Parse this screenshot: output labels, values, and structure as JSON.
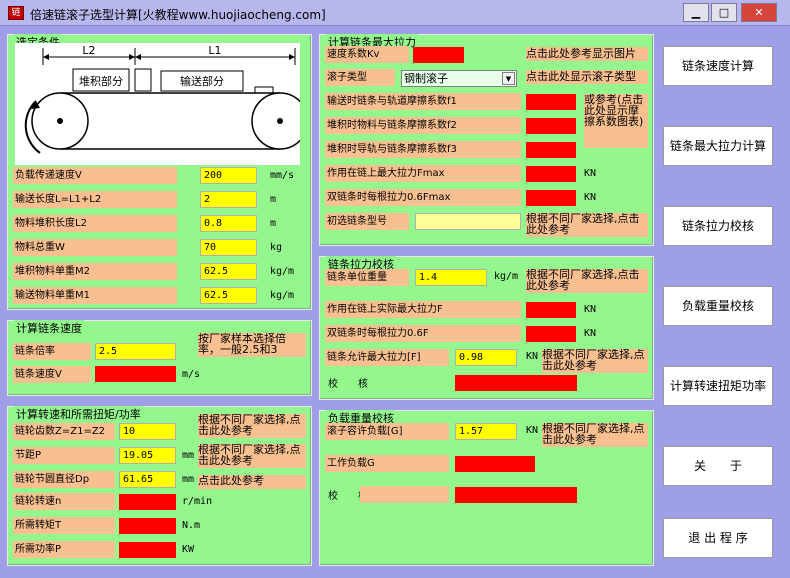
{
  "window": {
    "title": "倍速链滚子选型计算[火教程www.huojiaocheng.com]",
    "minimize": "▁",
    "maximize": "□",
    "close": "✕",
    "app_icon": "链"
  },
  "selection": {
    "title": "选定条件",
    "diagram": {
      "l2": "L2",
      "l1": "L1",
      "accum": "堆积部分",
      "convey": "输送部分"
    },
    "rows": [
      {
        "label": "负载传递速度V",
        "value": "200",
        "unit": "mm/s"
      },
      {
        "label": "输送长度L=L1+L2",
        "value": "2",
        "unit": "m"
      },
      {
        "label": "物料堆积长度L2",
        "value": "0.8",
        "unit": "m"
      },
      {
        "label": "物料总重W",
        "value": "70",
        "unit": "kg"
      },
      {
        "label": "堆积物料单重M2",
        "value": "62.5",
        "unit": "kg/m"
      },
      {
        "label": "输送物料单重M1",
        "value": "62.5",
        "unit": "kg/m"
      }
    ]
  },
  "speed": {
    "title": "计算链条速度",
    "ratio_label": "链条倍率",
    "ratio_value": "2.5",
    "ratio_note": "按厂家样本选择倍率，一般2.5和3",
    "speed_label": "链条速度V",
    "speed_unit": "m/s"
  },
  "torque": {
    "title": "计算转速和所需扭矩/功率",
    "teeth_label": "链轮齿数Z=Z1=Z2",
    "teeth_value": "10",
    "teeth_note": "根据不同厂家选择,点击此处参考",
    "pitch_label": "节距P",
    "pitch_value": "19.05",
    "pitch_unit": "mm",
    "pitch_note": "根据不同厂家选择,点击此处参考",
    "dia_label": "链轮节圆直径Dp",
    "dia_value": "61.65",
    "dia_unit": "mm",
    "dia_note": "点击此处参考",
    "rpm_label": "链轮转速n",
    "rpm_unit": "r/min",
    "tq_label": "所需转矩T",
    "tq_unit": "N.m",
    "pw_label": "所需功率P",
    "pw_unit": "KW"
  },
  "tension": {
    "title": "计算链条最大拉力",
    "kv_label": "速度系数Kv",
    "kv_note": "点击此处参考显示图片",
    "roller_label": "滚子类型",
    "roller_value": "钢制滚子",
    "roller_note": "点击此处显示滚子类型",
    "f1_label": "输送时链条与轨道摩擦系数f1",
    "f2_label": "堆积时物料与链条摩擦系数f2",
    "f3_label": "堆积时导轨与链条摩擦系数f3",
    "friction_note": "或参考(点击此处显示摩擦系数图表)",
    "fmax_label": "作用在链上最大拉力Fmax",
    "fmax_unit": "KN",
    "f06_label": "双链条时每根拉力0.6Fmax",
    "f06_unit": "KN",
    "model_label": "初选链条型号",
    "model_note": "根据不同厂家选择,点击此处参考"
  },
  "check": {
    "title": "链条拉力校核",
    "unitw_label": "链条单位重量",
    "unitw_value": "1.4",
    "unitw_unit": "kg/m",
    "unitw_note": "根据不同厂家选择,点击此处参考",
    "actual_label": "作用在链上实际最大拉力F",
    "actual_unit": "KN",
    "double_label": "双链条时每根拉力0.6F",
    "double_unit": "KN",
    "allow_label": "链条允许最大拉力[F]",
    "allow_value": "0.98",
    "allow_unit": "KN",
    "allow_note": "根据不同厂家选择,点击此处参考",
    "verify_label": "校　　核"
  },
  "load": {
    "title": "负载重量校核",
    "cap_label": "滚子容许负载[G]",
    "cap_value": "1.57",
    "cap_unit": "KN",
    "cap_note": "根据不同厂家选择,点击此处参考",
    "work_label": "工作负载G",
    "verify_label": "校　　核"
  },
  "buttons": [
    "链条速度计算",
    "链条最大拉力计算",
    "链条拉力校核",
    "负载重量校核",
    "计算转速扭矩功率",
    "关　　于",
    "退 出 程 序"
  ],
  "colors": {
    "panel": "#93f78e",
    "label": "#f8c090",
    "input": "#ffff00",
    "result": "#ff0000",
    "background": "#9f9fe8"
  }
}
